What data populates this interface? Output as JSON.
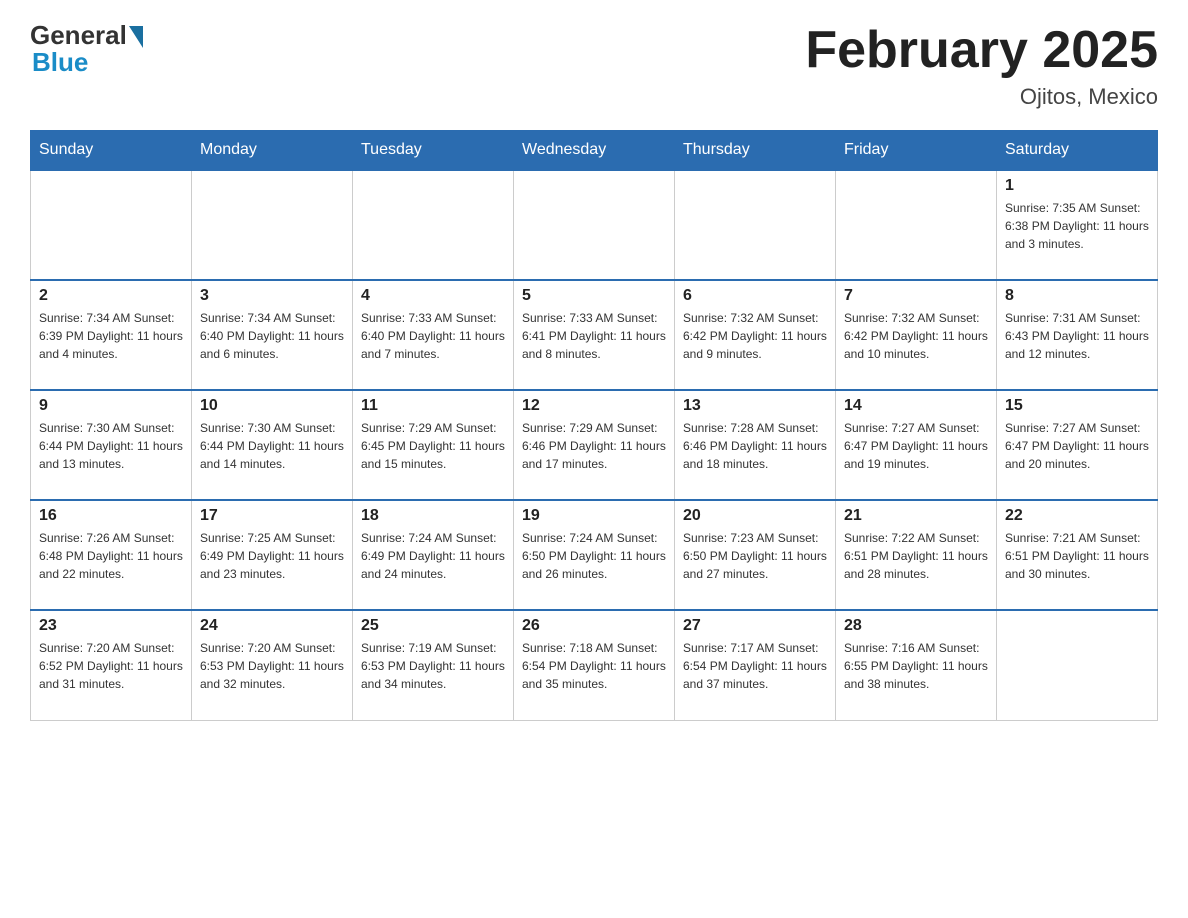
{
  "header": {
    "logo_general": "General",
    "logo_blue": "Blue",
    "month_title": "February 2025",
    "location": "Ojitos, Mexico"
  },
  "days_of_week": [
    "Sunday",
    "Monday",
    "Tuesday",
    "Wednesday",
    "Thursday",
    "Friday",
    "Saturday"
  ],
  "weeks": [
    {
      "days": [
        {
          "num": "",
          "info": ""
        },
        {
          "num": "",
          "info": ""
        },
        {
          "num": "",
          "info": ""
        },
        {
          "num": "",
          "info": ""
        },
        {
          "num": "",
          "info": ""
        },
        {
          "num": "",
          "info": ""
        },
        {
          "num": "1",
          "info": "Sunrise: 7:35 AM\nSunset: 6:38 PM\nDaylight: 11 hours\nand 3 minutes."
        }
      ]
    },
    {
      "days": [
        {
          "num": "2",
          "info": "Sunrise: 7:34 AM\nSunset: 6:39 PM\nDaylight: 11 hours\nand 4 minutes."
        },
        {
          "num": "3",
          "info": "Sunrise: 7:34 AM\nSunset: 6:40 PM\nDaylight: 11 hours\nand 6 minutes."
        },
        {
          "num": "4",
          "info": "Sunrise: 7:33 AM\nSunset: 6:40 PM\nDaylight: 11 hours\nand 7 minutes."
        },
        {
          "num": "5",
          "info": "Sunrise: 7:33 AM\nSunset: 6:41 PM\nDaylight: 11 hours\nand 8 minutes."
        },
        {
          "num": "6",
          "info": "Sunrise: 7:32 AM\nSunset: 6:42 PM\nDaylight: 11 hours\nand 9 minutes."
        },
        {
          "num": "7",
          "info": "Sunrise: 7:32 AM\nSunset: 6:42 PM\nDaylight: 11 hours\nand 10 minutes."
        },
        {
          "num": "8",
          "info": "Sunrise: 7:31 AM\nSunset: 6:43 PM\nDaylight: 11 hours\nand 12 minutes."
        }
      ]
    },
    {
      "days": [
        {
          "num": "9",
          "info": "Sunrise: 7:30 AM\nSunset: 6:44 PM\nDaylight: 11 hours\nand 13 minutes."
        },
        {
          "num": "10",
          "info": "Sunrise: 7:30 AM\nSunset: 6:44 PM\nDaylight: 11 hours\nand 14 minutes."
        },
        {
          "num": "11",
          "info": "Sunrise: 7:29 AM\nSunset: 6:45 PM\nDaylight: 11 hours\nand 15 minutes."
        },
        {
          "num": "12",
          "info": "Sunrise: 7:29 AM\nSunset: 6:46 PM\nDaylight: 11 hours\nand 17 minutes."
        },
        {
          "num": "13",
          "info": "Sunrise: 7:28 AM\nSunset: 6:46 PM\nDaylight: 11 hours\nand 18 minutes."
        },
        {
          "num": "14",
          "info": "Sunrise: 7:27 AM\nSunset: 6:47 PM\nDaylight: 11 hours\nand 19 minutes."
        },
        {
          "num": "15",
          "info": "Sunrise: 7:27 AM\nSunset: 6:47 PM\nDaylight: 11 hours\nand 20 minutes."
        }
      ]
    },
    {
      "days": [
        {
          "num": "16",
          "info": "Sunrise: 7:26 AM\nSunset: 6:48 PM\nDaylight: 11 hours\nand 22 minutes."
        },
        {
          "num": "17",
          "info": "Sunrise: 7:25 AM\nSunset: 6:49 PM\nDaylight: 11 hours\nand 23 minutes."
        },
        {
          "num": "18",
          "info": "Sunrise: 7:24 AM\nSunset: 6:49 PM\nDaylight: 11 hours\nand 24 minutes."
        },
        {
          "num": "19",
          "info": "Sunrise: 7:24 AM\nSunset: 6:50 PM\nDaylight: 11 hours\nand 26 minutes."
        },
        {
          "num": "20",
          "info": "Sunrise: 7:23 AM\nSunset: 6:50 PM\nDaylight: 11 hours\nand 27 minutes."
        },
        {
          "num": "21",
          "info": "Sunrise: 7:22 AM\nSunset: 6:51 PM\nDaylight: 11 hours\nand 28 minutes."
        },
        {
          "num": "22",
          "info": "Sunrise: 7:21 AM\nSunset: 6:51 PM\nDaylight: 11 hours\nand 30 minutes."
        }
      ]
    },
    {
      "days": [
        {
          "num": "23",
          "info": "Sunrise: 7:20 AM\nSunset: 6:52 PM\nDaylight: 11 hours\nand 31 minutes."
        },
        {
          "num": "24",
          "info": "Sunrise: 7:20 AM\nSunset: 6:53 PM\nDaylight: 11 hours\nand 32 minutes."
        },
        {
          "num": "25",
          "info": "Sunrise: 7:19 AM\nSunset: 6:53 PM\nDaylight: 11 hours\nand 34 minutes."
        },
        {
          "num": "26",
          "info": "Sunrise: 7:18 AM\nSunset: 6:54 PM\nDaylight: 11 hours\nand 35 minutes."
        },
        {
          "num": "27",
          "info": "Sunrise: 7:17 AM\nSunset: 6:54 PM\nDaylight: 11 hours\nand 37 minutes."
        },
        {
          "num": "28",
          "info": "Sunrise: 7:16 AM\nSunset: 6:55 PM\nDaylight: 11 hours\nand 38 minutes."
        },
        {
          "num": "",
          "info": ""
        }
      ]
    }
  ]
}
